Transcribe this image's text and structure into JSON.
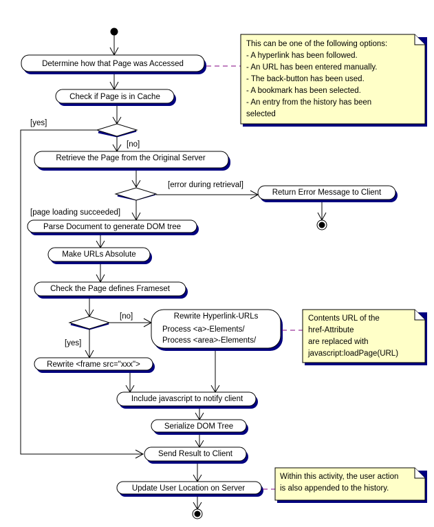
{
  "diagram": {
    "type": "UML activity diagram",
    "colors": {
      "shadow": "#000080",
      "note_fill": "#ffffc8",
      "note_link": "#800080",
      "line": "#000000",
      "background": "#ffffff"
    },
    "activities": [
      {
        "id": "determine",
        "label": "Determine how that Page was Accessed"
      },
      {
        "id": "check_cache",
        "label": "Check if Page is in Cache"
      },
      {
        "id": "retrieve",
        "label": "Retrieve the Page from the Original Server"
      },
      {
        "id": "return_error",
        "label": "Return Error Message to Client"
      },
      {
        "id": "parse",
        "label": "Parse Document to generate DOM tree"
      },
      {
        "id": "make_absolute",
        "label": "Make URLs Absolute"
      },
      {
        "id": "check_frameset",
        "label": "Check the Page defines Frameset"
      },
      {
        "id": "rewrite_hyperlinks",
        "label": "Rewrite Hyperlink-URLs",
        "lines": [
          "Process <a>-Elements/",
          "Process <area>-Elements/"
        ]
      },
      {
        "id": "rewrite_frame",
        "label": "Rewrite <frame src=\"xxx\">"
      },
      {
        "id": "include_js",
        "label": "Include javascript to notify client"
      },
      {
        "id": "serialize",
        "label": "Serialize DOM Tree"
      },
      {
        "id": "send_result",
        "label": "Send Result to Client"
      },
      {
        "id": "update_location",
        "label": "Update User Location on Server"
      }
    ],
    "guards": {
      "cache_yes": "[yes]",
      "cache_no": "[no]",
      "error": "[error during retrieval]",
      "success": "[page loading succeeded]",
      "frameset_no": "[no]",
      "frameset_yes": "[yes]"
    },
    "notes": [
      {
        "id": "access_options",
        "attached_to": "determine",
        "lines": [
          "This can be one of the following options:",
          "- A hyperlink has been followed.",
          "- An URL has been entered manually.",
          "- The back-button has been used.",
          "- A bookmark has been selected.",
          "- An entry from the history has been",
          "selected"
        ]
      },
      {
        "id": "href_note",
        "attached_to": "rewrite_hyperlinks",
        "lines": [
          "Contents URL of the",
          "href-Attribute",
          "are replaced with",
          "javascript:loadPage(URL)"
        ]
      },
      {
        "id": "history_note",
        "attached_to": "update_location",
        "lines": [
          "Within this activity, the user action",
          "is also appended to the history."
        ]
      }
    ]
  }
}
